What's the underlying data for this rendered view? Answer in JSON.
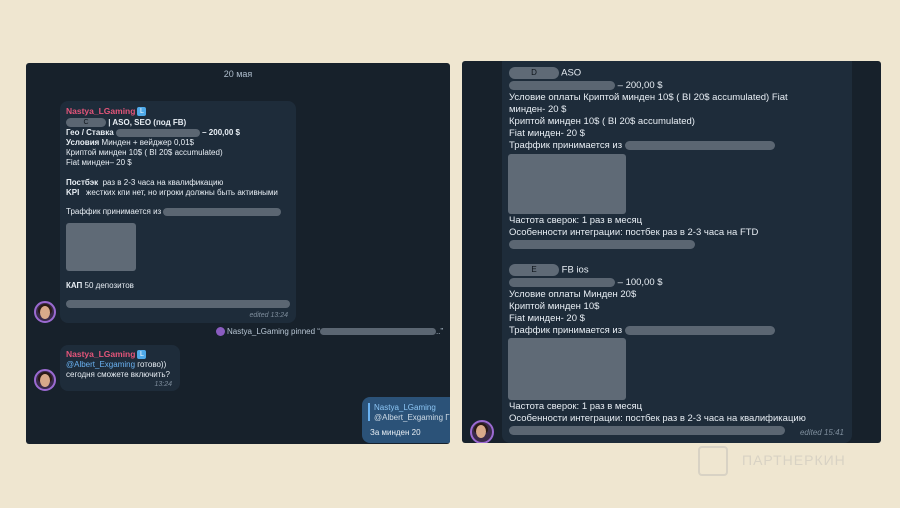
{
  "left": {
    "date": "20 мая",
    "msg1": {
      "sender": "Nastya_LGaming",
      "badge": "L",
      "tag_c": "C",
      "title_tail": "| ASO, SEO (под FB)",
      "geo_label": "Гео / Ставка",
      "geo_value": "– 200,00 $",
      "cond_label": "Условия",
      "cond_value": "Минден + вейджер 0,01$",
      "crypto": "Криптой минден 10$ ( BI 20$ accumulated)",
      "fiat": "Fiat минден– 20 $",
      "postback_label": "Постбэк",
      "postback_value": "раз в 2-3 часа на квалификацию",
      "kpi_label": "KPI",
      "kpi_value": "жестких кпи нет, но игроки должны быть активными",
      "traffic": "Траффик принимается из",
      "cap_label": "КАП",
      "cap_value": "50 депозитов",
      "time": "edited 13:24"
    },
    "pinned": {
      "text": "Nastya_LGaming pinned “",
      "tail": "..”"
    },
    "msg2": {
      "sender": "Nastya_LGaming",
      "badge": "L",
      "mention": "@Albert_Exgaming",
      "text1": "готово))",
      "text2": "сегодня сможете включить?",
      "time": "13:24"
    },
    "out": {
      "reply_name": "Nastya_LGaming",
      "reply_text": "@Albert_Exgaming Г",
      "text": "За минден 20"
    }
  },
  "right": {
    "d_tag": "D",
    "d_title": "ASO",
    "d_price": "– 200,00 $",
    "d_cond": "Условие оплаты Криптой минден 10$ ( BI 20$ accumulated)  Fiat",
    "d_cond2": "минден- 20 $",
    "d_crypto": "Криптой минден 10$ ( BI 20$ accumulated)",
    "d_fiat": "Fiat минден- 20 $",
    "d_traffic": "Траффик принимается из",
    "d_freq": "Частота сверок: 1 раз в месяц",
    "d_integr": "Особенности интеграции: постбек раз в 2-3 часа на FTD",
    "e_tag": "E",
    "e_title": "FB ios",
    "e_price": "– 100,00 $",
    "e_cond": "Условие оплаты Минден 20$",
    "e_crypto": "Криптой минден 10$",
    "e_fiat": "Fiat минден- 20 $",
    "e_traffic": "Траффик принимается из",
    "e_freq": "Частота сверок: 1 раз в месяц",
    "e_integr": "Особенности интеграции: постбек раз в 2-3 часа на квалификацию",
    "time": "edited 15:41"
  },
  "watermark": "ПАРТНЕРКИН",
  "colors": {
    "panel": "#17212b",
    "bubble": "#1e2c3a",
    "sender": "#e4557a",
    "outgoing": "#2b5278",
    "page": "#efe6d0"
  }
}
